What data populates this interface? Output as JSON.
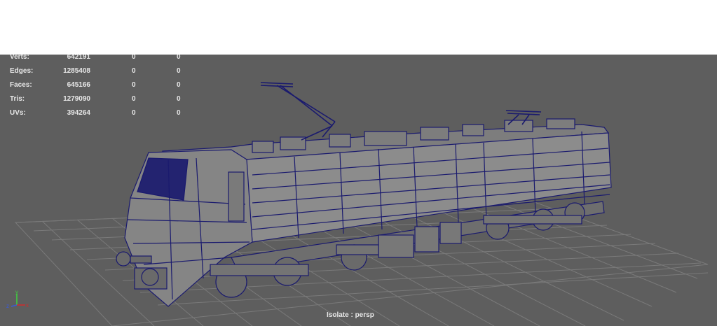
{
  "hud": {
    "rows": [
      {
        "label": "Verts:",
        "total": "642191",
        "selected": "0",
        "extra": "0"
      },
      {
        "label": "Edges:",
        "total": "1285408",
        "selected": "0",
        "extra": "0"
      },
      {
        "label": "Faces:",
        "total": "645166",
        "selected": "0",
        "extra": "0"
      },
      {
        "label": "Tris:",
        "total": "1279090",
        "selected": "0",
        "extra": "0"
      },
      {
        "label": "UVs:",
        "total": "394264",
        "selected": "0",
        "extra": "0"
      }
    ]
  },
  "camera": {
    "label": "Isolate : persp"
  },
  "axis": {
    "y": "y",
    "z": "z",
    "x": "x"
  },
  "colors": {
    "viewport_bg": "#5e5e5e",
    "grid": "#7a7a7a",
    "wire": "#1a1a6e",
    "body_fill": "#8c8c8c",
    "axis_x": "#d22a2a",
    "axis_y": "#3fd23f",
    "axis_z": "#3a5ad8"
  }
}
